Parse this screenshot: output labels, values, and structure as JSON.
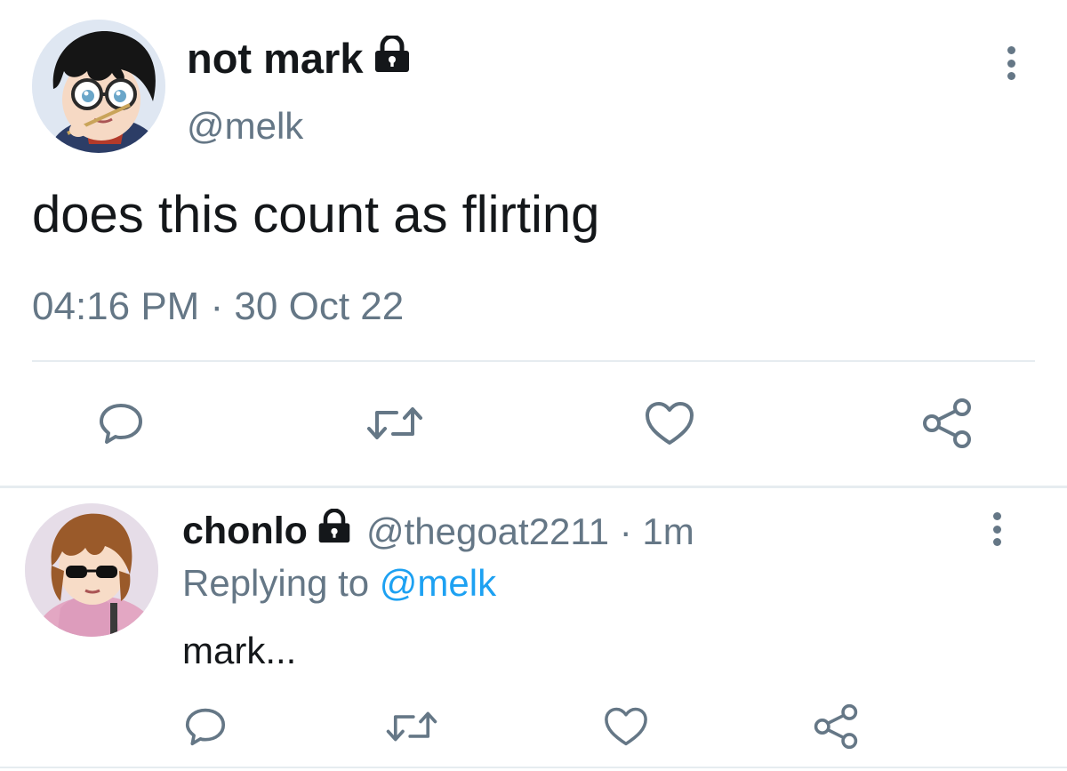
{
  "tweet": {
    "display_name": "not mark",
    "handle": "@melk",
    "text": "does this count as flirting",
    "timestamp": "04:16 PM · 30 Oct 22",
    "avatar_icon": "anime-boy-glasses-avatar",
    "locked_icon": "lock-icon"
  },
  "actions": [
    "reply-icon",
    "retweet-icon",
    "like-icon",
    "share-icon"
  ],
  "reply": {
    "display_name": "chonlo",
    "handle_time": "@thegoat2211 · 1m",
    "replying_prefix": "Replying to",
    "replying_to": "@melk",
    "text": "mark...",
    "avatar_icon": "anime-girl-sunglasses-avatar"
  },
  "colors": {
    "text": "#14171a",
    "secondary": "#657786",
    "link": "#1da1f2",
    "divider": "#e6ecf0"
  }
}
